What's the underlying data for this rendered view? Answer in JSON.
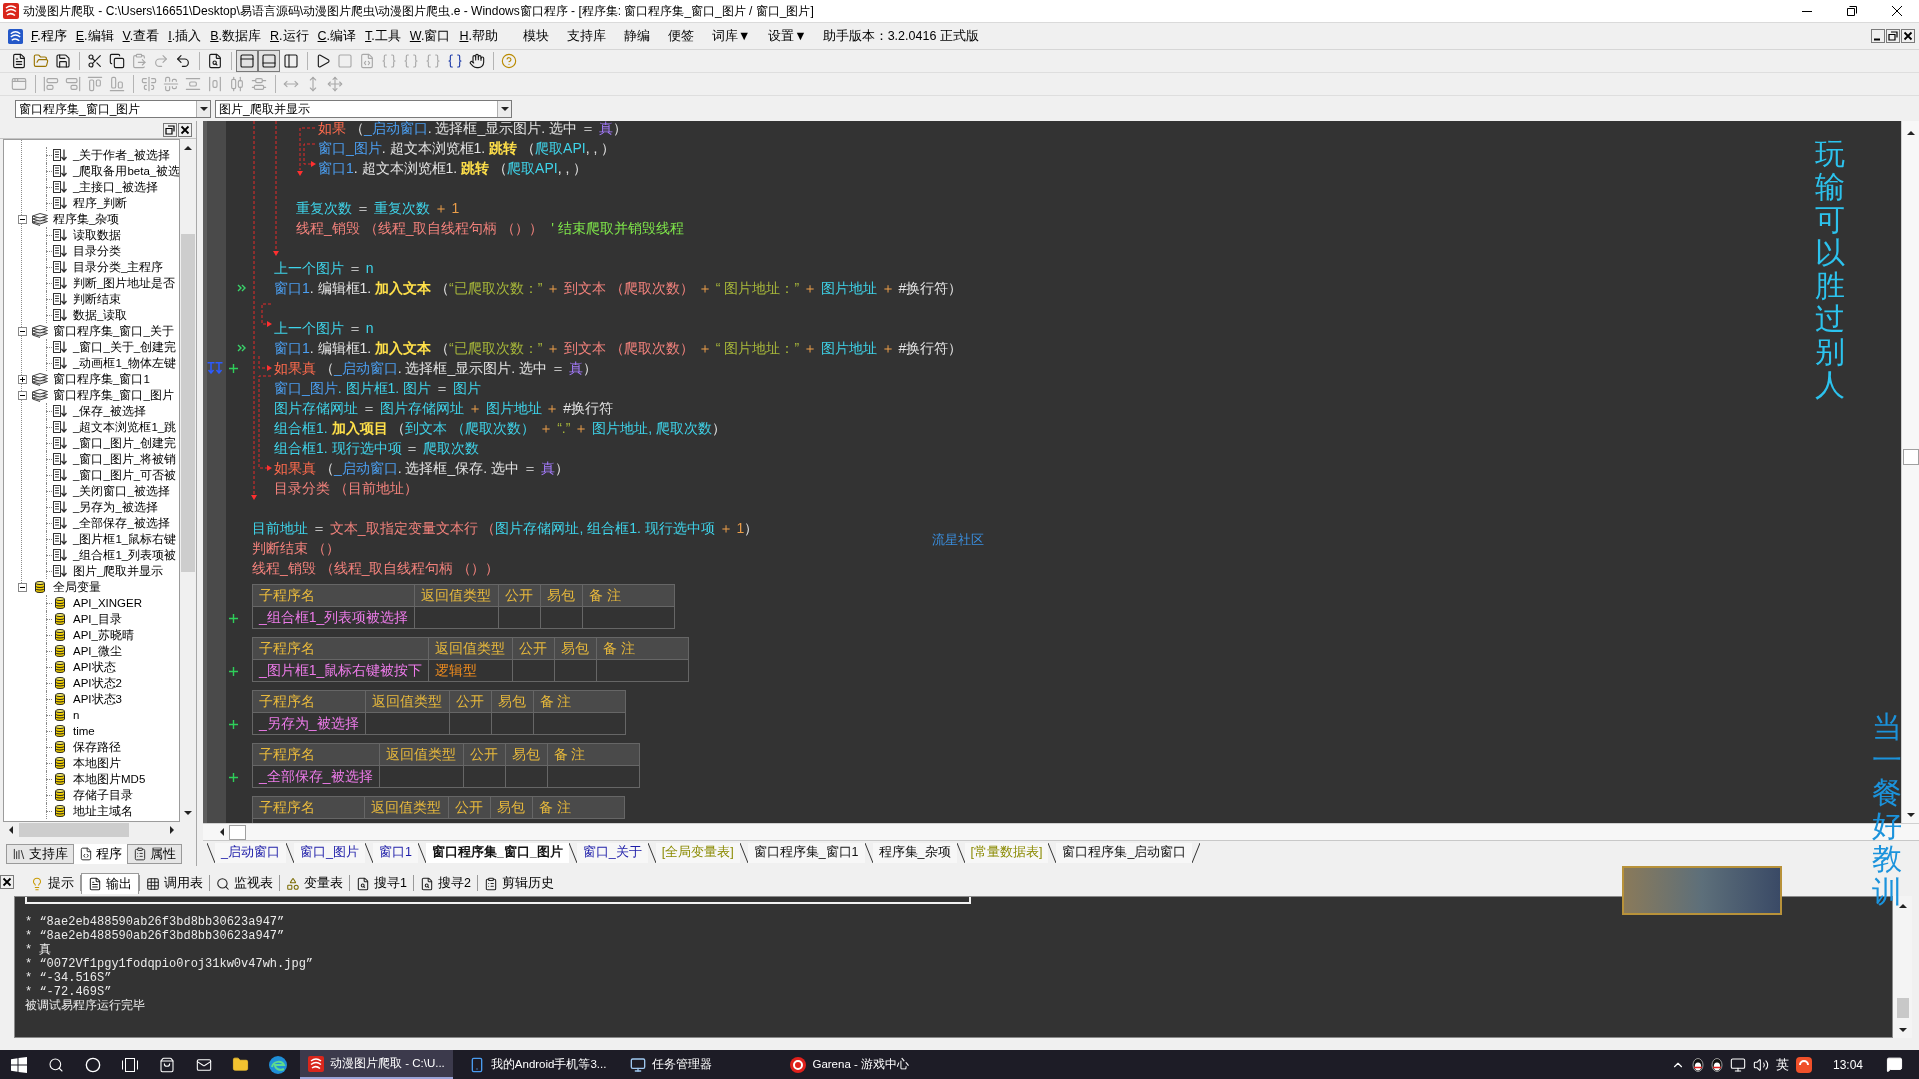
{
  "window": {
    "title": "动漫图片爬取 - C:\\Users\\16651\\Desktop\\易语言源码\\动漫图片爬虫\\动漫图片爬虫.e - Windows窗口程序 - [程序集: 窗口程序集_窗口_图片 / 窗口_图片]"
  },
  "menu": {
    "items": [
      {
        "key": "F",
        "label": ".程序"
      },
      {
        "key": "E",
        "label": ".编辑"
      },
      {
        "key": "V",
        "label": ".查看"
      },
      {
        "key": "I",
        "label": ".插入"
      },
      {
        "key": "B",
        "label": ".数据库"
      },
      {
        "key": "R",
        "label": ".运行"
      },
      {
        "key": "C",
        "label": ".编译"
      },
      {
        "key": "T",
        "label": ".工具"
      },
      {
        "key": "W",
        "label": ".窗口"
      },
      {
        "key": "H",
        "label": ".帮助"
      }
    ],
    "extras": [
      "模块",
      "支持库",
      "静编",
      "便签",
      "词库▼",
      "设置▼"
    ],
    "version": "助手版本：3.2.0416 正式版"
  },
  "toolbars": [
    {
      "groups": [
        [
          {
            "disabled": false
          },
          {
            "disabled": false
          },
          {
            "disabled": false
          }
        ],
        [
          {
            "disabled": false
          },
          {
            "disabled": false
          },
          {
            "disabled": true
          },
          {
            "disabled": true
          },
          {
            "disabled": false
          }
        ],
        [
          {
            "disabled": false
          }
        ],
        [
          {
            "disabled": false,
            "pressed": true
          },
          {
            "disabled": false,
            "pressed": true
          },
          {
            "disabled": false,
            "pressed": false
          }
        ],
        [
          {
            "disabled": false
          },
          {
            "disabled": true
          },
          {
            "disabled": true
          },
          {
            "disabled": true
          },
          {
            "disabled": true
          },
          {
            "disabled": true
          },
          {
            "disabled": false
          },
          {
            "disabled": false
          }
        ],
        [
          {
            "disabled": false
          }
        ]
      ]
    },
    {
      "groups": [
        [
          {
            "disabled": true
          }
        ],
        [
          {
            "disabled": true
          },
          {
            "disabled": true
          },
          {
            "disabled": true
          },
          {
            "disabled": true
          }
        ],
        [
          {
            "disabled": true
          },
          {
            "disabled": true
          },
          {
            "disabled": true
          },
          {
            "disabled": true
          },
          {
            "disabled": true
          },
          {
            "disabled": true
          }
        ],
        [
          {
            "disabled": true
          },
          {
            "disabled": true
          },
          {
            "disabled": true
          }
        ]
      ]
    }
  ],
  "selectors": [
    {
      "value": "窗口程序集_窗口_图片"
    },
    {
      "value": "图片_爬取并显示"
    }
  ],
  "project_panel": {
    "tree": [
      {
        "children": [
          {
            "label": "_关于作者_被选择",
            "kind": "sub"
          },
          {
            "label": "_爬取备用beta_被选",
            "kind": "sub"
          },
          {
            "label": "_主接口_被选择",
            "kind": "sub"
          },
          {
            "label": "程序_判断",
            "kind": "sub"
          }
        ]
      },
      {
        "label": "程序集_杂项",
        "kind": "module",
        "expanded": true,
        "children": [
          {
            "label": "读取数据",
            "kind": "sub"
          },
          {
            "label": "目录分类",
            "kind": "sub"
          },
          {
            "label": "目录分类_主程序",
            "kind": "sub"
          },
          {
            "label": "判断_图片地址是否",
            "kind": "sub"
          },
          {
            "label": "判断结束",
            "kind": "sub"
          },
          {
            "label": "数据_读取",
            "kind": "sub"
          }
        ]
      },
      {
        "label": "窗口程序集_窗口_关于",
        "kind": "module",
        "expanded": true,
        "children": [
          {
            "label": "_窗口_关于_创建完",
            "kind": "sub"
          },
          {
            "label": "_动画框1_物体左键",
            "kind": "sub"
          }
        ]
      },
      {
        "label": "窗口程序集_窗口1",
        "kind": "module",
        "expanded": false
      },
      {
        "label": "窗口程序集_窗口_图片",
        "kind": "module",
        "expanded": true,
        "children": [
          {
            "label": "_保存_被选择",
            "kind": "sub"
          },
          {
            "label": "_超文本浏览框1_跳",
            "kind": "sub"
          },
          {
            "label": "_窗口_图片_创建完",
            "kind": "sub"
          },
          {
            "label": "_窗口_图片_将被销",
            "kind": "sub"
          },
          {
            "label": "_窗口_图片_可否被",
            "kind": "sub"
          },
          {
            "label": "_关闭窗口_被选择",
            "kind": "sub"
          },
          {
            "label": "_另存为_被选择",
            "kind": "sub"
          },
          {
            "label": "_全部保存_被选择",
            "kind": "sub"
          },
          {
            "label": "_图片框1_鼠标右键",
            "kind": "sub"
          },
          {
            "label": "_组合框1_列表项被",
            "kind": "sub"
          },
          {
            "label": "图片_爬取并显示",
            "kind": "sub"
          }
        ]
      },
      {
        "label": "全局变量",
        "kind": "var",
        "expanded": true,
        "children": [
          {
            "label": "API_XINGER",
            "kind": "var"
          },
          {
            "label": "API_目录",
            "kind": "var"
          },
          {
            "label": "API_苏晓晴",
            "kind": "var"
          },
          {
            "label": "API_微尘",
            "kind": "var"
          },
          {
            "label": "API状态",
            "kind": "var"
          },
          {
            "label": "API状态2",
            "kind": "var"
          },
          {
            "label": "API状态3",
            "kind": "var"
          },
          {
            "label": "n",
            "kind": "var"
          },
          {
            "label": "time",
            "kind": "var"
          },
          {
            "label": "保存路径",
            "kind": "var"
          },
          {
            "label": "本地图片",
            "kind": "var"
          },
          {
            "label": "本地图片MD5",
            "kind": "var"
          },
          {
            "label": "存储子目录",
            "kind": "var"
          },
          {
            "label": "地址主域名",
            "kind": "var"
          }
        ]
      }
    ],
    "tabs": [
      {
        "label": "支持库",
        "selected": false
      },
      {
        "label": "程序",
        "selected": true
      },
      {
        "label": "属性",
        "selected": false
      }
    ]
  },
  "editor": {
    "lines": [
      {
        "kind": "block",
        "children": [
          {
            "kind": "block",
            "children": [
              {
                "kind": "block",
                "children": [
                  {
                    "kind": "code",
                    "tokens": [
                      {
                        "kind": "keyword",
                        "text": "如果"
                      },
                      {
                        "kind": "plain",
                        "text": " （"
                      },
                      {
                        "kind": "window",
                        "text": "_启动窗口"
                      },
                      {
                        "kind": "plain",
                        "text": ". 选择框_显示图片. 选中 ＝ "
                      },
                      {
                        "kind": "constant",
                        "text": "真"
                      },
                      {
                        "kind": "plain",
                        "text": "）"
                      }
                    ]
                  },
                  {
                    "kind": "code",
                    "tokens": [
                      {
                        "kind": "window",
                        "text": "窗口_图片"
                      },
                      {
                        "kind": "plain",
                        "text": ". 超文本浏览框1. "
                      },
                      {
                        "kind": "method",
                        "text": "跳转"
                      },
                      {
                        "kind": "plain",
                        "text": " （"
                      },
                      {
                        "kind": "variable",
                        "text": "爬取API"
                      },
                      {
                        "kind": "plain",
                        "text": ", , ）"
                      }
                    ]
                  },
                  {
                    "kind": "code",
                    "tokens": [
                      {
                        "kind": "window",
                        "text": "窗口1"
                      },
                      {
                        "kind": "plain",
                        "text": ". 超文本浏览框1. "
                      },
                      {
                        "kind": "method",
                        "text": "跳转"
                      },
                      {
                        "kind": "plain",
                        "text": " （"
                      },
                      {
                        "kind": "variable",
                        "text": "爬取API"
                      },
                      {
                        "kind": "plain",
                        "text": ", , ）"
                      }
                    ]
                  }
                ]
              },
              {
                "kind": "blank"
              },
              {
                "kind": "code",
                "tokens": [
                  {
                    "kind": "variable",
                    "text": "重复次数"
                  },
                  {
                    "kind": "plain",
                    "text": " ＝ "
                  },
                  {
                    "kind": "variable",
                    "text": "重复次数"
                  },
                  {
                    "kind": "operator",
                    "text": " ＋ "
                  },
                  {
                    "kind": "number",
                    "text": "1"
                  }
                ]
              },
              {
                "kind": "code",
                "tokens": [
                  {
                    "kind": "command",
                    "text": "线程_销毁 （线程_取自线程句柄 （））"
                  },
                  {
                    "kind": "comment",
                    "text": "  ' 结束爬取并销毁线程"
                  }
                ]
              }
            ]
          },
          {
            "kind": "blank"
          },
          {
            "kind": "code",
            "tokens": [
              {
                "kind": "variable",
                "text": "上一个图片"
              },
              {
                "kind": "plain",
                "text": " ＝ "
              },
              {
                "kind": "variable",
                "text": "n"
              }
            ]
          },
          {
            "kind": "marked",
            "tokens": [
              {
                "kind": "window",
                "text": "窗口1"
              },
              {
                "kind": "plain",
                "text": ". 编辑框1. "
              },
              {
                "kind": "method",
                "text": "加入文本"
              },
              {
                "kind": "plain",
                "text": " （"
              },
              {
                "kind": "string",
                "text": "“已爬取次数：”"
              },
              {
                "kind": "operator",
                "text": " ＋ "
              },
              {
                "kind": "command",
                "text": "到文本 （爬取次数）"
              },
              {
                "kind": "operator",
                "text": " ＋ "
              },
              {
                "kind": "string",
                "text": "“ 图片地址：”"
              },
              {
                "kind": "operator",
                "text": " ＋ "
              },
              {
                "kind": "variable",
                "text": "图片地址"
              },
              {
                "kind": "operator",
                "text": " ＋ "
              },
              {
                "kind": "plain",
                "text": "#换行符）"
              }
            ]
          },
          {
            "kind": "blank"
          },
          {
            "kind": "code",
            "tokens": [
              {
                "kind": "variable",
                "text": "上一个图片"
              },
              {
                "kind": "plain",
                "text": " ＝ "
              },
              {
                "kind": "variable",
                "text": "n"
              }
            ]
          },
          {
            "kind": "marked",
            "tokens": [
              {
                "kind": "window",
                "text": "窗口1"
              },
              {
                "kind": "plain",
                "text": ". 编辑框1. "
              },
              {
                "kind": "method",
                "text": "加入文本"
              },
              {
                "kind": "plain",
                "text": " （"
              },
              {
                "kind": "string",
                "text": "“已爬取次数：”"
              },
              {
                "kind": "operator",
                "text": " ＋ "
              },
              {
                "kind": "command",
                "text": "到文本 （爬取次数）"
              },
              {
                "kind": "operator",
                "text": " ＋ "
              },
              {
                "kind": "string",
                "text": "“ 图片地址：”"
              },
              {
                "kind": "operator",
                "text": " ＋ "
              },
              {
                "kind": "variable",
                "text": "图片地址"
              },
              {
                "kind": "operator",
                "text": " ＋ "
              },
              {
                "kind": "plain",
                "text": "#换行符）"
              }
            ]
          },
          {
            "kind": "current",
            "tokens": [
              {
                "kind": "keyword",
                "text": "如果真"
              },
              {
                "kind": "plain",
                "text": " （"
              },
              {
                "kind": "window",
                "text": "_启动窗口"
              },
              {
                "kind": "plain",
                "text": ". 选择框_显示图片. 选中 ＝ "
              },
              {
                "kind": "constant",
                "text": "真"
              },
              {
                "kind": "plain",
                "text": "）"
              }
            ]
          },
          {
            "kind": "code",
            "tokens": [
              {
                "kind": "window",
                "text": "窗口_图片"
              },
              {
                "kind": "variable",
                "text": ". 图片框1. 图片"
              },
              {
                "kind": "plain",
                "text": " ＝ "
              },
              {
                "kind": "variable",
                "text": "图片"
              }
            ]
          },
          {
            "kind": "code",
            "tokens": [
              {
                "kind": "variable",
                "text": "图片存储网址"
              },
              {
                "kind": "plain",
                "text": " ＝ "
              },
              {
                "kind": "variable",
                "text": "图片存储网址"
              },
              {
                "kind": "operator",
                "text": " ＋ "
              },
              {
                "kind": "variable",
                "text": "图片地址"
              },
              {
                "kind": "operator",
                "text": " ＋ "
              },
              {
                "kind": "plain",
                "text": "#换行符"
              }
            ]
          },
          {
            "kind": "code",
            "tokens": [
              {
                "kind": "variable",
                "text": "组合框1. "
              },
              {
                "kind": "method",
                "text": "加入项目"
              },
              {
                "kind": "plain",
                "text": " （"
              },
              {
                "kind": "variable",
                "text": "到文本 （爬取次数）"
              },
              {
                "kind": "operator",
                "text": " ＋ "
              },
              {
                "kind": "string",
                "text": "“.”"
              },
              {
                "kind": "operator",
                "text": " ＋ "
              },
              {
                "kind": "variable",
                "text": "图片地址, 爬取次数"
              },
              {
                "kind": "plain",
                "text": "）"
              }
            ]
          },
          {
            "kind": "code",
            "tokens": [
              {
                "kind": "variable",
                "text": "组合框1. 现行选中项"
              },
              {
                "kind": "plain",
                "text": " ＝ "
              },
              {
                "kind": "variable",
                "text": "爬取次数"
              }
            ]
          },
          {
            "kind": "code",
            "tokens": [
              {
                "kind": "keyword",
                "text": "如果真"
              },
              {
                "kind": "plain",
                "text": " （"
              },
              {
                "kind": "window",
                "text": "_启动窗口"
              },
              {
                "kind": "plain",
                "text": ". 选择框_保存. 选中 ＝ "
              },
              {
                "kind": "constant",
                "text": "真"
              },
              {
                "kind": "plain",
                "text": "）"
              }
            ]
          },
          {
            "kind": "code",
            "tokens": [
              {
                "kind": "command",
                "text": "目录分类 （目前地址）"
              }
            ]
          }
        ]
      },
      {
        "kind": "blank"
      },
      {
        "kind": "code",
        "tokens": [
          {
            "kind": "variable",
            "text": "目前地址"
          },
          {
            "kind": "plain",
            "text": " ＝ "
          },
          {
            "kind": "command",
            "text": "文本_取指定变量文本行 （"
          },
          {
            "kind": "variable",
            "text": "图片存储网址, 组合框1. 现行选中项"
          },
          {
            "kind": "operator",
            "text": " ＋ "
          },
          {
            "kind": "number",
            "text": "1"
          },
          {
            "kind": "plain",
            "text": "）"
          }
        ]
      },
      {
        "kind": "code",
        "tokens": [
          {
            "kind": "command",
            "text": "判断结束 （）"
          }
        ]
      },
      {
        "kind": "code",
        "tokens": [
          {
            "kind": "command",
            "text": "线程_销毁 （线程_取自线程句柄 （））"
          }
        ]
      }
    ],
    "community_link": "流星社区",
    "procedures": [
      {
        "columns": [
          "子程序名",
          "返回值类型",
          "公开",
          "易包",
          "备 注"
        ],
        "cells": [
          "_组合框1_列表项被选择"
        ],
        "expanded": false
      },
      {
        "columns": [
          "子程序名",
          "返回值类型",
          "公开",
          "易包",
          "备 注"
        ],
        "cells": [
          "_图片框1_鼠标右键被按下",
          "逻辑型"
        ],
        "expanded": false
      },
      {
        "columns": [
          "子程序名",
          "返回值类型",
          "公开",
          "易包",
          "备 注"
        ],
        "cells": [
          "_另存为_被选择"
        ],
        "expanded": false
      },
      {
        "columns": [
          "子程序名",
          "返回值类型",
          "公开",
          "易包",
          "备 注"
        ],
        "cells": [
          "_全部保存_被选择"
        ],
        "expanded": false
      },
      {
        "columns": [
          "子程序名",
          "返回值类型",
          "公开",
          "易包",
          "备 注"
        ]
      }
    ],
    "tabs": [
      {
        "label": "_启动窗口",
        "kind": "window",
        "selected": false
      },
      {
        "label": "窗口_图片",
        "kind": "window",
        "selected": false
      },
      {
        "label": "窗口1",
        "kind": "window",
        "selected": false
      },
      {
        "label": "窗口程序集_窗口_图片",
        "kind": "module",
        "selected": true
      },
      {
        "label": "窗口_关于",
        "kind": "window",
        "selected": false
      },
      {
        "label": "[全局变量表]",
        "kind": "table",
        "selected": false
      },
      {
        "label": "窗口程序集_窗口1",
        "kind": "module",
        "selected": false
      },
      {
        "label": "程序集_杂项",
        "kind": "module",
        "selected": false
      },
      {
        "label": "[常量数据表]",
        "kind": "table",
        "selected": false
      },
      {
        "label": "窗口程序集_启动窗口",
        "kind": "module",
        "selected": false
      }
    ]
  },
  "bottom_panel": {
    "tabs": [
      {
        "label": "提示",
        "selected": false
      },
      {
        "label": "输出",
        "selected": true
      },
      {
        "label": "调用表",
        "selected": false
      },
      {
        "label": "监视表",
        "selected": false
      },
      {
        "label": "变量表",
        "selected": false
      },
      {
        "label": "搜寻1",
        "selected": false
      },
      {
        "label": "搜寻2",
        "selected": false
      },
      {
        "label": "剪辑历史",
        "selected": false
      }
    ],
    "output": [
      "* “8ae2eb488590ab26f3bd8bb30623a947”",
      "* “8ae2eb488590ab26f3bd8bb30623a947”",
      "* 真",
      "* “0072Vf1pgy1fodqpio0roj31kw0v47wh.jpg”",
      "* “-34.516S”",
      "* “-72.469S”",
      "被调试易程序运行完毕"
    ]
  },
  "overlay_texts": [
    "玩输可以胜过别人",
    "当一餐好教训"
  ],
  "taskbar": {
    "apps": [
      {
        "label": "动漫图片爬取 - C:\\U...",
        "selected": true
      },
      {
        "label": "我的Android手机等3...",
        "selected": false
      },
      {
        "label": "任务管理器",
        "selected": false
      },
      {
        "label": "Garena - 游戏中心",
        "selected": false
      }
    ],
    "ime": "英",
    "clock": "13:04"
  }
}
